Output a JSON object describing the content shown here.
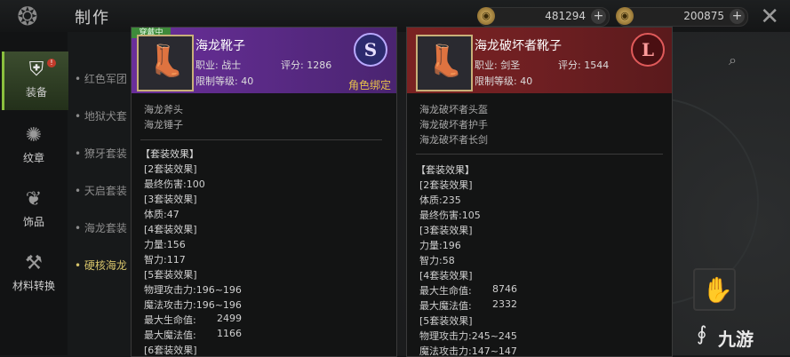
{
  "header": {
    "title": "制作"
  },
  "currency": [
    {
      "icon": "gold-coin-icon",
      "value": "481294"
    },
    {
      "icon": "gold-coin-icon",
      "value": "200875"
    }
  ],
  "sidebar": {
    "items": [
      {
        "label": "装备",
        "icon": "equipment-icon",
        "active": true
      },
      {
        "label": "纹章",
        "icon": "emblem-icon",
        "active": false
      },
      {
        "label": "饰品",
        "icon": "accessory-icon",
        "active": false
      },
      {
        "label": "材料转换",
        "icon": "anvil-icon",
        "active": false
      }
    ]
  },
  "set_list": {
    "items": [
      {
        "label": "红色军团"
      },
      {
        "label": "地狱犬套"
      },
      {
        "label": "獠牙套装"
      },
      {
        "label": "天启套装"
      },
      {
        "label": "海龙套装"
      },
      {
        "label": "硬核海龙"
      }
    ]
  },
  "card_left": {
    "tag": "穿戴中",
    "name": "海龙靴子",
    "job_label": "职业: 战士",
    "score_label": "评分: 1286",
    "level_label": "限制等级: 40",
    "grade": "S",
    "bind": "角色绑定",
    "set_items": [
      "海龙斧头",
      "海龙锤子"
    ],
    "effect_title": "【套装效果】",
    "effects": [
      {
        "label": "[2套装效果]",
        "value": ""
      },
      {
        "label": "最终伤害:100",
        "value": ""
      },
      {
        "label": "[3套装效果]",
        "value": ""
      },
      {
        "label": "体质:47",
        "value": ""
      },
      {
        "label": "[4套装效果]",
        "value": ""
      },
      {
        "label": "力量:156",
        "value": ""
      },
      {
        "label": "智力:117",
        "value": ""
      },
      {
        "label": "[5套装效果]",
        "value": ""
      },
      {
        "label": "物理攻击力:196~196",
        "value": ""
      },
      {
        "label": "魔法攻击力:196~196",
        "value": ""
      },
      {
        "label": "最大生命值:",
        "value": "2499"
      },
      {
        "label": "最大魔法值:",
        "value": "1166"
      },
      {
        "label": "[6套装效果]",
        "value": ""
      }
    ]
  },
  "card_right": {
    "name": "海龙破坏者靴子",
    "job_label": "职业: 剑圣",
    "score_label": "评分: 1544",
    "level_label": "限制等级: 40",
    "grade": "L",
    "set_items": [
      "海龙破坏者头盔",
      "海龙破坏者护手",
      "海龙破坏者长剑"
    ],
    "effect_title": "【套装效果】",
    "effects": [
      {
        "label": "[2套装效果]",
        "value": ""
      },
      {
        "label": "体质:235",
        "value": ""
      },
      {
        "label": "最终伤害:105",
        "value": ""
      },
      {
        "label": "[3套装效果]",
        "value": ""
      },
      {
        "label": "力量:196",
        "value": ""
      },
      {
        "label": "智力:58",
        "value": ""
      },
      {
        "label": "[4套装效果]",
        "value": ""
      },
      {
        "label": "最大生命值:",
        "value": "8746"
      },
      {
        "label": "最大魔法值:",
        "value": "2332"
      },
      {
        "label": "[5套装效果]",
        "value": ""
      },
      {
        "label": "物理攻击力:245~245",
        "value": ""
      },
      {
        "label": "魔法攻击力:147~147",
        "value": ""
      }
    ]
  },
  "watermark": {
    "text": "九游"
  }
}
